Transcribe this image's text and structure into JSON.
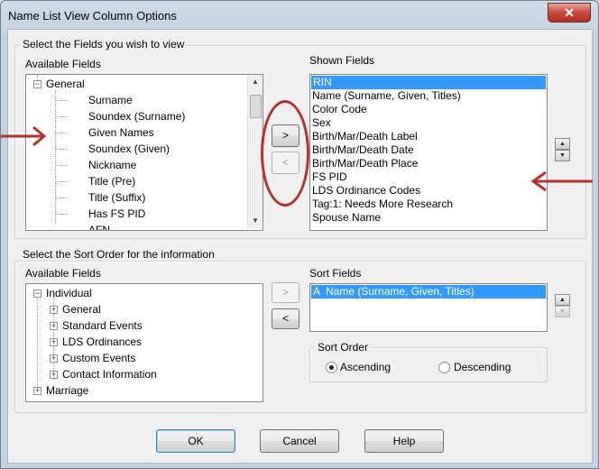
{
  "window": {
    "title": "Name List View Column Options",
    "close_glyph": "✕"
  },
  "fields_group": {
    "legend": "Select the Fields you wish to view",
    "available_label": "Available Fields",
    "shown_label": "Shown Fields",
    "available_items": [
      {
        "label": "General",
        "expander": "−"
      },
      {
        "label": "Surname"
      },
      {
        "label": "Soundex (Surname)"
      },
      {
        "label": "Given Names"
      },
      {
        "label": "Soundex (Given)"
      },
      {
        "label": "Nickname"
      },
      {
        "label": "Title (Pre)"
      },
      {
        "label": "Title (Suffix)"
      },
      {
        "label": "Has FS PID"
      },
      {
        "label": "AFN"
      }
    ],
    "shown_items": [
      {
        "label": "RIN",
        "selected": true
      },
      {
        "label": "Name (Surname, Given, Titles)"
      },
      {
        "label": "Color Code"
      },
      {
        "label": "Sex"
      },
      {
        "label": "Birth/Mar/Death Label"
      },
      {
        "label": "Birth/Mar/Death Date"
      },
      {
        "label": "Birth/Mar/Death Place"
      },
      {
        "label": "FS PID"
      },
      {
        "label": "LDS Ordinance Codes"
      },
      {
        "label": "Tag:1: Needs More Research"
      },
      {
        "label": "Spouse Name"
      }
    ],
    "add_button": ">",
    "remove_button": "<",
    "move_up": "▲",
    "move_down": "▼"
  },
  "sort_group": {
    "legend": "Select the Sort Order for the information",
    "available_label": "Available Fields",
    "sort_label": "Sort Fields",
    "available_items": [
      {
        "label": "Individual",
        "expander": "−",
        "level": 0
      },
      {
        "label": "General",
        "expander": "+",
        "level": 1
      },
      {
        "label": "Standard Events",
        "expander": "+",
        "level": 1
      },
      {
        "label": "LDS Ordinances",
        "expander": "+",
        "level": 1
      },
      {
        "label": "Custom Events",
        "expander": "+",
        "level": 1
      },
      {
        "label": "Contact Information",
        "expander": "+",
        "level": 1
      },
      {
        "label": "Marriage",
        "expander": "+",
        "level": 0
      }
    ],
    "sort_items": [
      {
        "label": "A  Name (Surname, Given, Titles)",
        "selected": true
      }
    ],
    "add_button": ">",
    "remove_button": "<",
    "move_up": "▲",
    "move_down": "▼",
    "sort_order": {
      "legend": "Sort Order",
      "ascending": "Ascending",
      "descending": "Descending",
      "selected": "Ascending"
    }
  },
  "footer": {
    "ok": "OK",
    "cancel": "Cancel",
    "help": "Help"
  },
  "annotation_color": "#b5322c"
}
